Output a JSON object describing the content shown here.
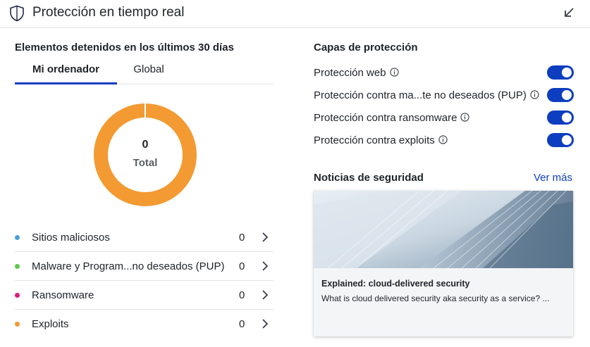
{
  "header": {
    "title": "Protección en tiempo real",
    "shield_icon": "shield-icon",
    "collapse_icon": "collapse-arrow-icon"
  },
  "stopped": {
    "title": "Elementos detenidos en los últimos 30 días",
    "tabs": [
      {
        "label": "Mi ordenador",
        "active": true
      },
      {
        "label": "Global",
        "active": false
      }
    ],
    "total_value": "0",
    "total_label": "Total",
    "items": [
      {
        "label": "Sitios maliciosos",
        "count": "0",
        "color": "#4a9fd8"
      },
      {
        "label": "Malware y Program...no deseados (PUP)",
        "count": "0",
        "color": "#5cc94a"
      },
      {
        "label": "Ransomware",
        "count": "0",
        "color": "#e0197d"
      },
      {
        "label": "Exploits",
        "count": "0",
        "color": "#f39a32"
      }
    ]
  },
  "layers": {
    "title": "Capas de protección",
    "items": [
      {
        "label": "Protección web",
        "enabled": true
      },
      {
        "label": "Protección contra ma...te no deseados (PUP)",
        "enabled": true
      },
      {
        "label": "Protección contra ransomware",
        "enabled": true
      },
      {
        "label": "Protección contra exploits",
        "enabled": true
      }
    ]
  },
  "news": {
    "title": "Noticias de seguridad",
    "more_label": "Ver más",
    "card": {
      "headline": "Explained: cloud-delivered security",
      "description": "What is cloud delivered security aka security as a service? ..."
    }
  },
  "colors": {
    "accent": "#0d3ec0",
    "donut": "#f39a32"
  }
}
